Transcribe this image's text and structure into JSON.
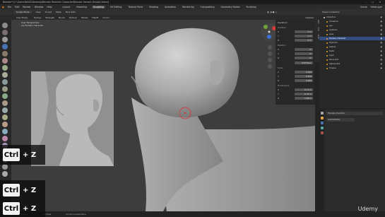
{
  "window": {
    "title": "Blender* [C:\\Users\\DAVID\\Desktop\\Blender Realistic Character\\Blender Female (Sculpt).blend]",
    "buttons": "– ▢ ✕"
  },
  "menu": {
    "items": [
      "File",
      "Edit",
      "Render",
      "Window",
      "Help"
    ],
    "workspaces": [
      "Layout",
      "Modeling",
      "Sculpting",
      "UV Editing",
      "Texture Paint",
      "Shading",
      "Animation",
      "Rendering",
      "Compositing",
      "Geometry Nodes",
      "Scripting"
    ],
    "active_workspace": "Sculpting",
    "scene": "Scene",
    "view_layer": "ViewLayer"
  },
  "viewport_header": {
    "mode": "Sculpt Mode",
    "items": [
      "View",
      "Sculpt",
      "Mask",
      "Face Sets"
    ],
    "brush": "Clay Strips",
    "tool_items": [
      "Radius",
      "Strength",
      "Brush",
      "Texture",
      "Stroke",
      "Falloff",
      "Cursor"
    ],
    "options": "Options"
  },
  "viewport_info": {
    "line1": "User Perspective",
    "line2": "(1) Female character"
  },
  "npanel": {
    "transform_title": "Transform",
    "location_label": "Location",
    "location": [
      {
        "axis": "X",
        "val": "0 m"
      },
      {
        "axis": "Y",
        "val": "0 m"
      },
      {
        "axis": "Z",
        "val": "0 m"
      }
    ],
    "rotation_label": "Rotation",
    "rotation": [
      {
        "axis": "X",
        "val": "0°"
      },
      {
        "axis": "Y",
        "val": "0°"
      },
      {
        "axis": "Z",
        "val": "0°"
      }
    ],
    "mode": "XYZ Euler",
    "scale_label": "Scale",
    "scale": [
      {
        "axis": "X",
        "val": "0.408"
      },
      {
        "axis": "Y",
        "val": "0.408"
      },
      {
        "axis": "Z",
        "val": "0.408"
      }
    ],
    "dimensions_label": "Dimensions",
    "dimensions": [
      {
        "axis": "X",
        "val": "0.71 m"
      },
      {
        "axis": "Y",
        "val": "0.32 m"
      },
      {
        "axis": "Z",
        "val": "1.68 m"
      }
    ],
    "tabs": [
      "Item",
      "Tool",
      "View"
    ]
  },
  "outliner": {
    "title": "Scene Collection",
    "rows": [
      {
        "label": "Collection",
        "selected": false,
        "color": "#ddd"
      },
      {
        "label": "Armature",
        "selected": false,
        "color": "#e8a33b"
      },
      {
        "label": "eye",
        "selected": false,
        "color": "#e8a33b"
      },
      {
        "label": "eyebrow",
        "selected": false,
        "color": "#e8a33b"
      },
      {
        "label": "eyes",
        "selected": false,
        "color": "#e8a33b"
      },
      {
        "label": "Female character",
        "selected": true,
        "color": "#e8a33b"
      },
      {
        "label": "Eyebrow",
        "selected": false,
        "color": "#e8a33b"
      },
      {
        "label": "Lashes",
        "selected": false,
        "color": "#e8a33b"
      },
      {
        "label": "Teeth",
        "selected": false,
        "color": "#e8a33b"
      },
      {
        "label": "Light",
        "selected": false,
        "color": "#e8a33b"
      },
      {
        "label": "Plane.001",
        "selected": false,
        "color": "#e8a33b"
      },
      {
        "label": "Sphere.001",
        "selected": false,
        "color": "#e8a33b"
      },
      {
        "label": "Tongue",
        "selected": false,
        "color": "#e8a33b"
      }
    ]
  },
  "properties": {
    "object_name": "Female character",
    "modifier_btn": "Add Modifier"
  },
  "status": {
    "left": "Select",
    "mid": "Pan View",
    "right": "Sculpt Context Menu"
  },
  "keys": {
    "combo1_key": "Ctrl",
    "combo1_rest": "+ Z",
    "combo2_key": "Ctrl",
    "combo2_rest": "+ Z",
    "combo3_key": "Ctrl",
    "combo3_rest": "+ Z"
  },
  "watermark": "Udemy",
  "colors": {
    "accent": "#4772b3",
    "brush_cursor": "#d43a3a",
    "selection": "#334d80"
  }
}
